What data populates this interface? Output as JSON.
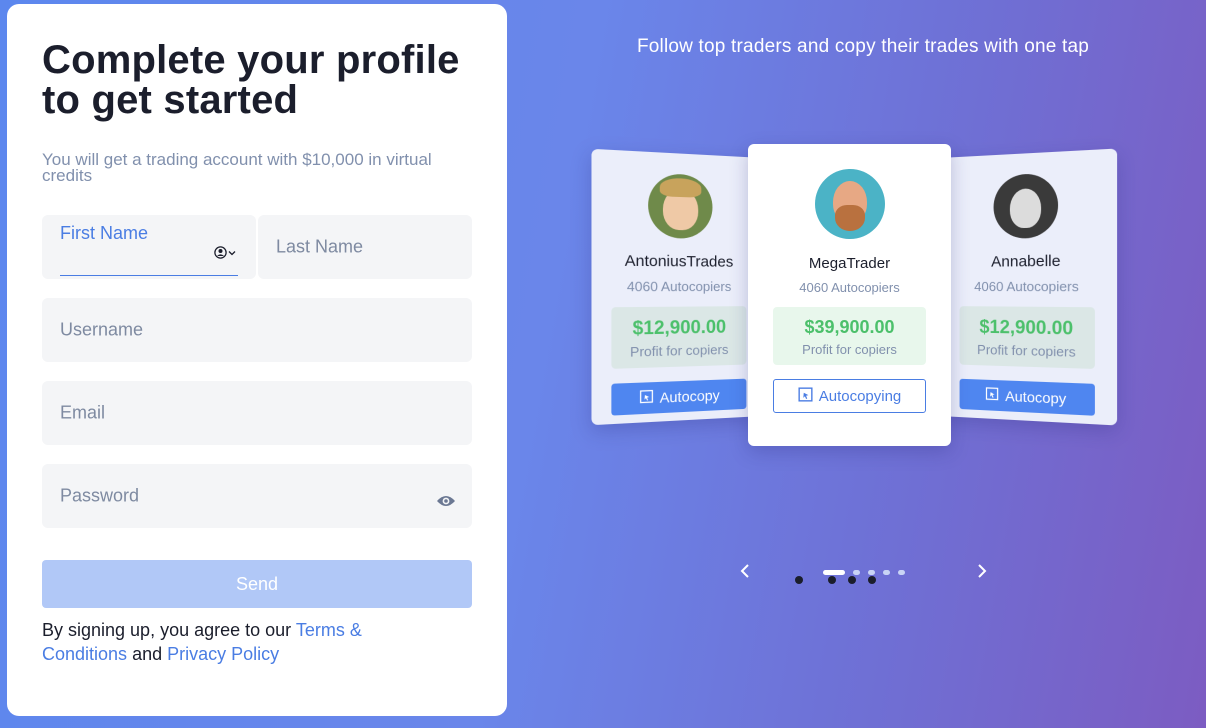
{
  "form": {
    "title": "Complete your profile to get started",
    "subtitle": "You will get a trading account with $10,000 in virtual credits",
    "first_name_label": "First Name",
    "last_name_placeholder": "Last Name",
    "username_placeholder": "Username",
    "email_placeholder": "Email",
    "password_placeholder": "Password",
    "send_label": "Send",
    "legal_prefix": "By signing up, you agree to our ",
    "terms_link": "Terms & Conditions",
    "legal_and": " and ",
    "privacy_link": "Privacy Policy"
  },
  "hero": {
    "title": "Follow top traders and copy their trades with one tap",
    "cards": [
      {
        "name": "AntoniusTrades",
        "copiers": "4060 Autocopiers",
        "profit": "$12,900.00",
        "profit_label": "Profit for copiers",
        "button": "Autocopy"
      },
      {
        "name": "MegaTrader",
        "copiers": "4060 Autocopiers",
        "profit": "$39,900.00",
        "profit_label": "Profit for copiers",
        "button": "Autocopying"
      },
      {
        "name": "Annabelle",
        "copiers": "4060 Autocopiers",
        "profit": "$12,900.00",
        "profit_label": "Profit for copiers",
        "button": "Autocopy"
      }
    ],
    "carousel": {
      "total_slides": 5,
      "active_slide": 1
    }
  },
  "colors": {
    "accent": "#4a7de3",
    "profit_green": "#4cc06b",
    "send_disabled": "#b1c8f7"
  },
  "icons": [
    "contact-picker-icon",
    "eye-icon",
    "autocopy-icon",
    "chevron-left-icon",
    "chevron-right-icon"
  ]
}
